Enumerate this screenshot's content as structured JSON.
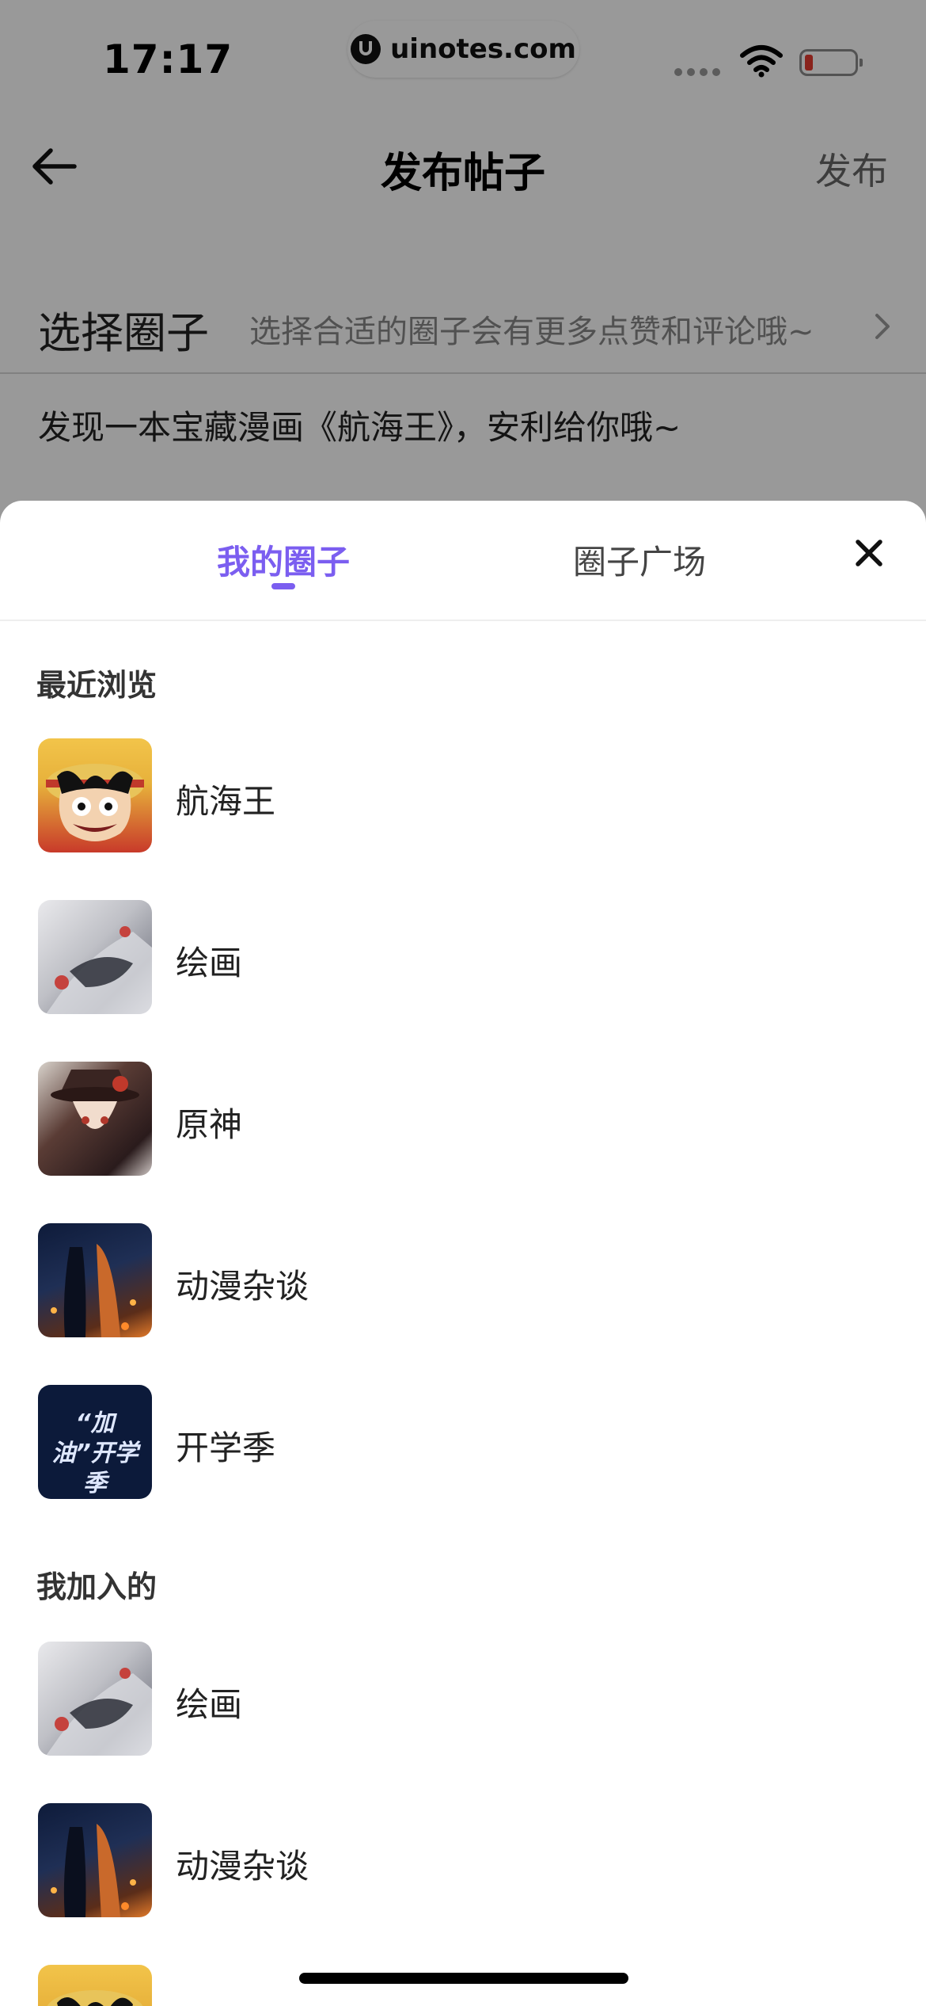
{
  "status_bar": {
    "time": "17:17",
    "url": "uinotes.com",
    "battery_color": "#e53b2f",
    "icons": [
      "signal-icon",
      "wifi-icon",
      "battery-icon"
    ]
  },
  "nav": {
    "title": "发布帖子",
    "publish_label": "发布",
    "back_icon": "arrow-left-icon"
  },
  "compose": {
    "select_label": "选择圈子",
    "select_hint": "选择合适的圈子会有更多点赞和评论哦~",
    "post_text": "发现一本宝藏漫画《航海王》，安利给你哦~"
  },
  "sheet": {
    "tabs": [
      {
        "label": "我的圈子",
        "active": true
      },
      {
        "label": "圈子广场",
        "active": false
      }
    ],
    "accent_color": "#7b5ef0",
    "recent_title": "最近浏览",
    "recent_items": [
      {
        "label": "航海王",
        "thumb": "onepiece"
      },
      {
        "label": "绘画",
        "thumb": "drawing"
      },
      {
        "label": "原神",
        "thumb": "genshin"
      },
      {
        "label": "动漫杂谈",
        "thumb": "anime"
      },
      {
        "label": "开学季",
        "thumb": "school",
        "thumb_text": "“加油”开学季"
      }
    ],
    "joined_title": "我加入的",
    "joined_items": [
      {
        "label": "绘画",
        "thumb": "drawing"
      },
      {
        "label": "动漫杂谈",
        "thumb": "anime"
      },
      {
        "label": "",
        "thumb": "onepiece"
      }
    ]
  }
}
